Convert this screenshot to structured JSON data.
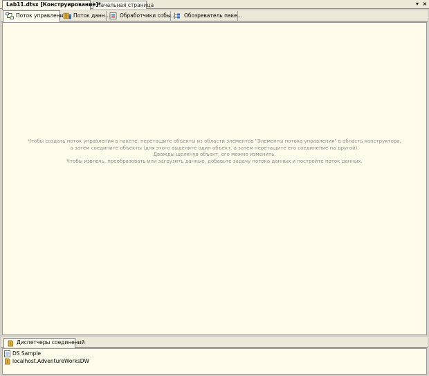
{
  "document_tabs": [
    {
      "label": "Lab11.dtsx [Конструирование]*",
      "active": true
    },
    {
      "label": "Начальная страница",
      "active": false
    }
  ],
  "window_controls": {
    "dropdown": "▾",
    "close": "×"
  },
  "designer_tabs": [
    {
      "label": "Поток управления",
      "icon": "control-flow-icon",
      "active": true
    },
    {
      "label": "Поток данн...",
      "icon": "data-flow-icon",
      "active": false
    },
    {
      "label": "Обработчики собы...",
      "icon": "event-handlers-icon",
      "active": false
    },
    {
      "label": "Обозреватель паке...",
      "icon": "package-explorer-icon",
      "active": false
    }
  ],
  "canvas": {
    "hint_lines": [
      "Чтобы создать поток управления в пакете, перетащите объекты из области элементов \"Элементы потока управления\" в область конструктора,",
      "а затем соедините объекты (для этого выделите один объект, а затем перетащите его соединение на другой).",
      "Дважды щелкнув объект, его можно изменить.",
      "Чтобы извлечь, преобразовать или загрузить данные, добавьте задачу потока данных и постройте поток данных."
    ]
  },
  "connection_managers": {
    "tab_label": "Диспетчеры соединений",
    "items": [
      {
        "label": "DS Sample",
        "icon": "data-source-icon"
      },
      {
        "label": "localhost.AdventureWorksDW",
        "icon": "ole-db-connection-icon"
      }
    ]
  },
  "colors": {
    "canvas_background": "#fffbea",
    "chrome": "#ece9d8",
    "hint_text": "#8c8c8c"
  }
}
